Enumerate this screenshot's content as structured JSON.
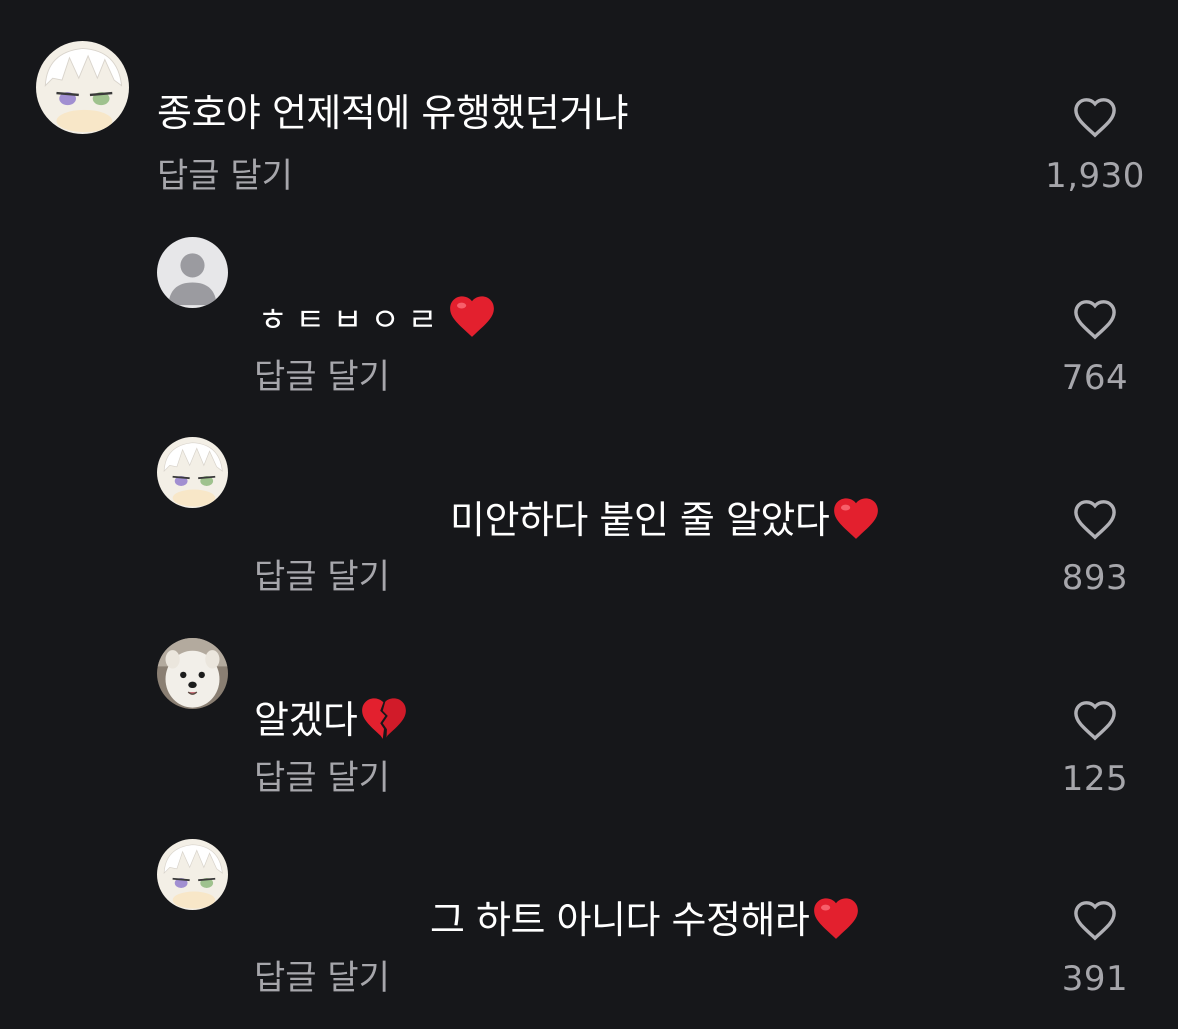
{
  "accent": {
    "background": "#16171a",
    "primary_text": "#ffffff",
    "secondary_text": "#a6a6ab",
    "heart_red": "#e3202e"
  },
  "comments": [
    {
      "avatar": "anime-character-avatar",
      "text": "종호야 언제적에 유행했던거냐",
      "emoji": "",
      "reply_label": "답글 달기",
      "likes": "1,930",
      "like_icon": "heart-outline-icon"
    },
    {
      "avatar": "default-user-avatar",
      "text": "ㅎㅌㅂㅇㄹ",
      "emoji": "red-heart-emoji",
      "reply_label": "답글 달기",
      "likes": "764",
      "like_icon": "heart-outline-icon"
    },
    {
      "avatar": "anime-character-avatar",
      "text": "미안하다 붙인 줄 알았다",
      "emoji": "red-heart-emoji",
      "reply_label": "답글 달기",
      "likes": "893",
      "like_icon": "heart-outline-icon"
    },
    {
      "avatar": "white-dog-avatar",
      "text": "알겠다",
      "emoji": "broken-heart-emoji",
      "reply_label": "답글 달기",
      "likes": "125",
      "like_icon": "heart-outline-icon"
    },
    {
      "avatar": "anime-character-avatar",
      "text": "그 하트 아니다 수정해라",
      "emoji": "red-heart-emoji",
      "reply_label": "답글 달기",
      "likes": "391",
      "like_icon": "heart-outline-icon"
    }
  ]
}
